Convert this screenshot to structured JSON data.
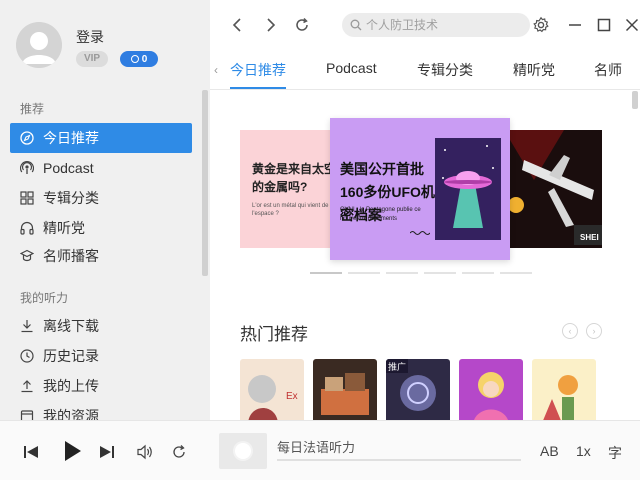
{
  "user": {
    "login_label": "登录",
    "vip_label": "VIP",
    "coin_count": "0"
  },
  "sidebar": {
    "section1": "推荐",
    "items1": [
      {
        "label": "今日推荐",
        "icon": "compass-icon"
      },
      {
        "label": "Podcast",
        "icon": "podcast-icon"
      },
      {
        "label": "专辑分类",
        "icon": "grid-icon"
      },
      {
        "label": "精听党",
        "icon": "headphones-icon"
      },
      {
        "label": "名师播客",
        "icon": "teacher-icon"
      }
    ],
    "section2": "我的听力",
    "items2": [
      {
        "label": "离线下载",
        "icon": "download-icon"
      },
      {
        "label": "历史记录",
        "icon": "history-icon"
      },
      {
        "label": "我的上传",
        "icon": "upload-icon"
      },
      {
        "label": "我的资源",
        "icon": "resource-icon"
      }
    ]
  },
  "topbar": {
    "search_placeholder": "个人防卫技术"
  },
  "tabs": [
    "今日推荐",
    "Podcast",
    "专辑分类",
    "精听党",
    "名师"
  ],
  "banners": {
    "left_title": "黄金是来自太空的金属吗?",
    "left_sub": "L'or est un métal qui vient de l'espace ?",
    "center_title": "美国公开首批160多份UFO机密档案",
    "center_sub": "OVNI : le Pentagone publie ce nouveaux documents",
    "right_text": "SHEI"
  },
  "hot": {
    "title": "热门推荐"
  },
  "cards": [
    {
      "name": "card-1",
      "color": "#f4e4d4"
    },
    {
      "name": "card-2",
      "color": "#3a2a22"
    },
    {
      "name": "card-3",
      "color": "#2e2a45",
      "tag": "推广"
    },
    {
      "name": "card-4",
      "color": "#b548c9"
    },
    {
      "name": "card-5",
      "color": "#fbf0c8"
    }
  ],
  "player": {
    "track_title": "每日法语听力",
    "ab_label": "AB",
    "speed_label": "1x",
    "subtitle_label": "字"
  },
  "colors": {
    "accent": "#2f8be6",
    "sidebar_bg": "#f0f0f0"
  }
}
